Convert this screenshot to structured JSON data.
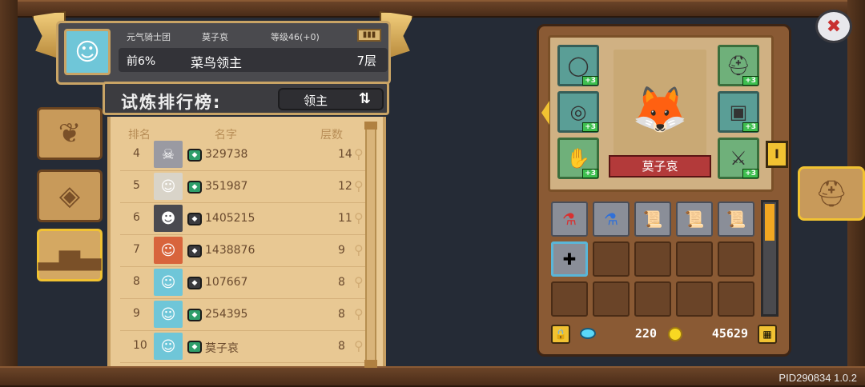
{
  "header": {
    "guild": "元气骑士团",
    "player_name": "莫子哀",
    "level_label": "等级46(+0)",
    "rank_percent": "前6%",
    "title": "菜鸟领主",
    "floor": "7层",
    "avatar_icon": "☺"
  },
  "ranking": {
    "title": "试炼排行榜:",
    "mode_label": "领主",
    "swap_icon": "⇅",
    "columns": {
      "rank": "排名",
      "name": "名字",
      "floor": "层数"
    },
    "rows": [
      {
        "rank": "4",
        "name": "329738",
        "floor": "14",
        "badge_color": "#2e9e6a",
        "avatar_bg": "#9a9aa2",
        "avatar_icon": "☠"
      },
      {
        "rank": "5",
        "name": "351987",
        "floor": "12",
        "badge_color": "#2e9e6a",
        "avatar_bg": "#d9d4c9",
        "avatar_icon": "☺"
      },
      {
        "rank": "6",
        "name": "1405215",
        "floor": "11",
        "badge_color": "#3a3a3e",
        "avatar_bg": "#4a4a50",
        "avatar_icon": "☻"
      },
      {
        "rank": "7",
        "name": "1438876",
        "floor": "9",
        "badge_color": "#3a3a3e",
        "avatar_bg": "#d8643c",
        "avatar_icon": "☺"
      },
      {
        "rank": "8",
        "name": "107667",
        "floor": "8",
        "badge_color": "#3a3a3e",
        "avatar_bg": "#6fc6d8",
        "avatar_icon": "☺"
      },
      {
        "rank": "9",
        "name": "254395",
        "floor": "8",
        "badge_color": "#2e9e6a",
        "avatar_bg": "#6fc6d8",
        "avatar_icon": "☺"
      },
      {
        "rank": "10",
        "name": "莫子哀",
        "floor": "8",
        "badge_color": "#2e9e6a",
        "avatar_bg": "#6fc6d8",
        "avatar_icon": "☺"
      }
    ]
  },
  "equipment": {
    "character_name": "莫子哀",
    "plus_label": "+3",
    "slots_left": [
      "necklace-icon",
      "ring-icon",
      "gauntlet-icon"
    ],
    "slots_right": [
      "helmet-icon",
      "armor-icon",
      "weapon-icon"
    ]
  },
  "inventory": {
    "items": [
      "red-potion-icon",
      "blue-potion-icon",
      "scroll-icon",
      "scroll-icon",
      "scroll-icon",
      "bandage-icon"
    ]
  },
  "currency": {
    "gems": "220",
    "coins": "45629"
  },
  "footer": {
    "pid": "PID290834 1.0.2"
  },
  "colors": {
    "accent_gold": "#f1c232",
    "frame_brown": "#6b4428",
    "scroll_paper": "#e8c893"
  }
}
